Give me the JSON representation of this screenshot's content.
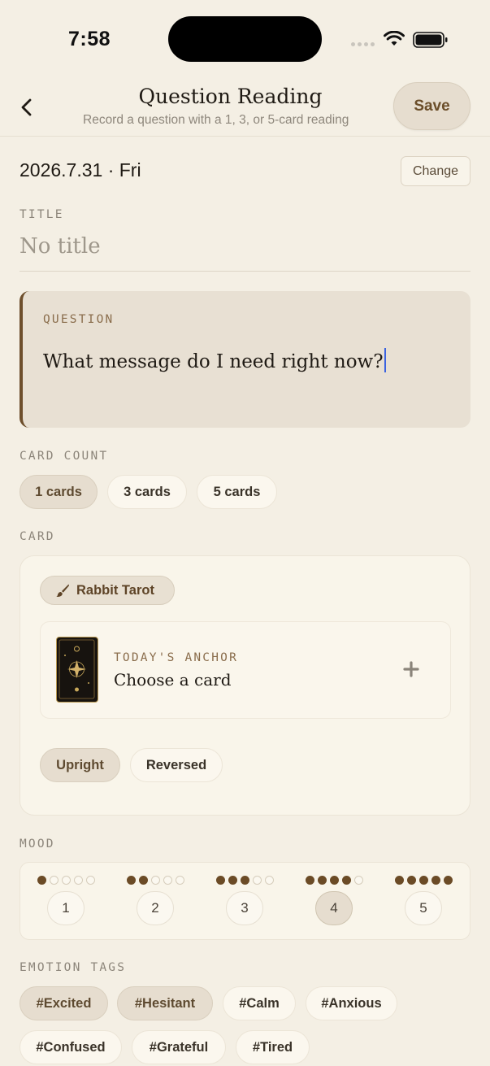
{
  "status": {
    "time": "7:58"
  },
  "header": {
    "title": "Question Reading",
    "subtitle": "Record a question with a 1, 3, or 5-card reading",
    "save_label": "Save"
  },
  "date": {
    "value": "2026.7.31 · Fri",
    "change_label": "Change"
  },
  "title_field": {
    "label": "TITLE",
    "placeholder": "No title"
  },
  "question": {
    "label": "QUESTION",
    "value": "What message do I need right now?"
  },
  "card_count": {
    "label": "CARD COUNT",
    "options": [
      "1 cards",
      "3 cards",
      "5 cards"
    ],
    "selected": "1 cards"
  },
  "card": {
    "label": "CARD",
    "deck_name": "Rabbit Tarot",
    "slot_label": "TODAY'S ANCHOR",
    "slot_placeholder": "Choose a card",
    "orientation": [
      "Upright",
      "Reversed"
    ],
    "selected_orientation": "Upright"
  },
  "mood": {
    "label": "MOOD",
    "options": [
      "1",
      "2",
      "3",
      "4",
      "5"
    ],
    "selected": 4
  },
  "emotion_tags": {
    "label": "EMOTION TAGS",
    "tags": [
      "#Excited",
      "#Hesitant",
      "#Calm",
      "#Anxious",
      "#Confused",
      "#Grateful",
      "#Tired"
    ],
    "selected": [
      "#Excited",
      "#Hesitant"
    ]
  },
  "colors": {
    "accent": "#6b4b26",
    "background": "#f4efe4",
    "caret": "#3b63e0"
  }
}
